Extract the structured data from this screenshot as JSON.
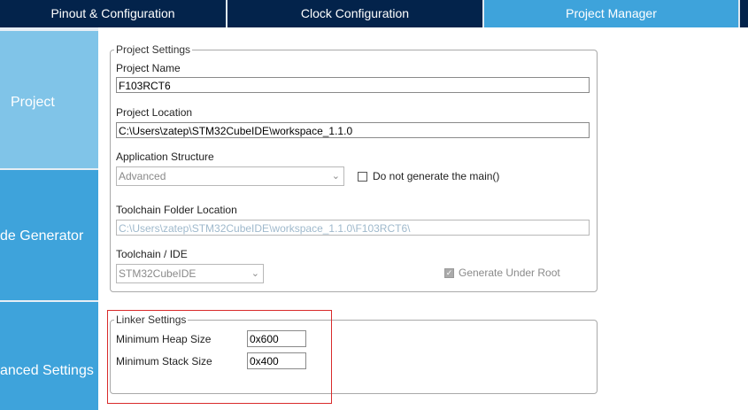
{
  "tabs": [
    {
      "label": "Pinout & Configuration"
    },
    {
      "label": "Clock Configuration"
    },
    {
      "label": "Project Manager"
    }
  ],
  "nav": [
    {
      "label": "Project"
    },
    {
      "label": "de Generator"
    },
    {
      "label": "anced Settings"
    }
  ],
  "project_settings": {
    "title": "Project Settings",
    "project_name_label": "Project Name",
    "project_name_value": "F103RCT6",
    "project_location_label": "Project Location",
    "project_location_value": "C:\\Users\\zatep\\STM32CubeIDE\\workspace_1.1.0",
    "app_structure_label": "Application Structure",
    "app_structure_value": "Advanced",
    "do_not_generate_main_label": "Do not generate the main()",
    "toolchain_folder_label": "Toolchain Folder Location",
    "toolchain_folder_value": "C:\\Users\\zatep\\STM32CubeIDE\\workspace_1.1.0\\F103RCT6\\",
    "toolchain_ide_label": "Toolchain / IDE",
    "toolchain_ide_value": "STM32CubeIDE",
    "generate_under_root_label": "Generate Under Root"
  },
  "linker_settings": {
    "title": "Linker Settings",
    "min_heap_label": "Minimum Heap Size",
    "min_heap_value": "0x600",
    "min_stack_label": "Minimum Stack Size",
    "min_stack_value": "0x400"
  },
  "colors": {
    "tab_bg": "#03234b",
    "tab_active": "#3ea3db",
    "nav_bg": "#3ea3db",
    "nav_active": "#80c4e8",
    "highlight": "#d92b2b"
  }
}
